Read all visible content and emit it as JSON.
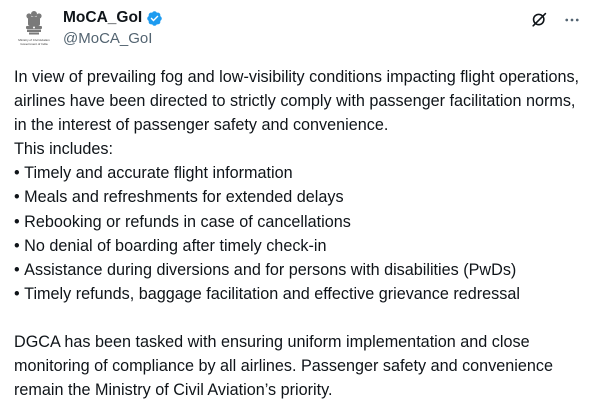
{
  "author": {
    "display_name": "MoCA_GoI",
    "handle": "@MoCA_GoI",
    "avatar_caption_line1": "Ministry of Civil Aviation",
    "avatar_caption_line2": "Government of India"
  },
  "icons": {
    "avatar": "national-emblem",
    "verified": "verified-badge",
    "grok": "grok-icon",
    "more": "more-icon"
  },
  "colors": {
    "verified": "#1d9bf0",
    "text": "#0f1419",
    "secondary_text": "#536471"
  },
  "tweet": {
    "intro": "In view of prevailing fog and low-visibility conditions impacting flight operations, airlines have been directed to strictly comply with passenger facilitation norms, in the interest of passenger safety and convenience.",
    "includes_label": "This includes:",
    "bullets": [
      "Timely and accurate flight information",
      "Meals and refreshments for extended delays",
      "Rebooking or refunds in case of cancellations",
      "No denial of boarding after timely check-in",
      "Assistance during diversions and for persons with disabilities (PwDs)",
      "Timely refunds, baggage facilitation and effective grievance redressal"
    ],
    "closing": "DGCA has been tasked with ensuring uniform implementation and close monitoring of compliance by all airlines. Passenger safety and convenience remain the Ministry of Civil Aviation’s priority."
  }
}
